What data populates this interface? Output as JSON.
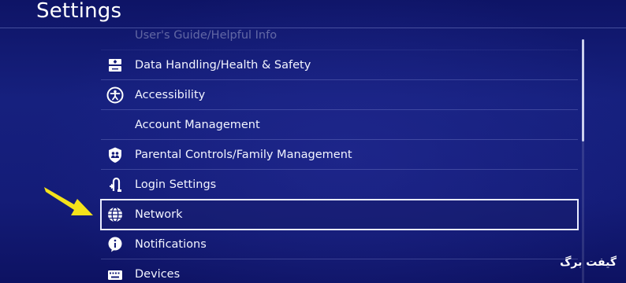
{
  "header": {
    "title": "Settings"
  },
  "menu": {
    "items": [
      {
        "label": "User's Guide/Helpful Info",
        "icon": "book-icon"
      },
      {
        "label": "Data Handling/Health & Safety",
        "icon": "console-icon"
      },
      {
        "label": "Accessibility",
        "icon": "accessibility-icon"
      },
      {
        "label": "Account Management",
        "icon": ""
      },
      {
        "label": "Parental Controls/Family Management",
        "icon": "family-shield-icon"
      },
      {
        "label": "Login Settings",
        "icon": "login-icon"
      },
      {
        "label": "Network",
        "icon": "globe-icon",
        "selected": true
      },
      {
        "label": "Notifications",
        "icon": "info-icon"
      },
      {
        "label": "Devices",
        "icon": "keyboard-icon"
      }
    ]
  },
  "watermark": {
    "text": "گیفت برگ"
  },
  "colors": {
    "background": "#141c78",
    "selection_border": "#e9ecff",
    "pointer_arrow": "#f4e21a"
  }
}
